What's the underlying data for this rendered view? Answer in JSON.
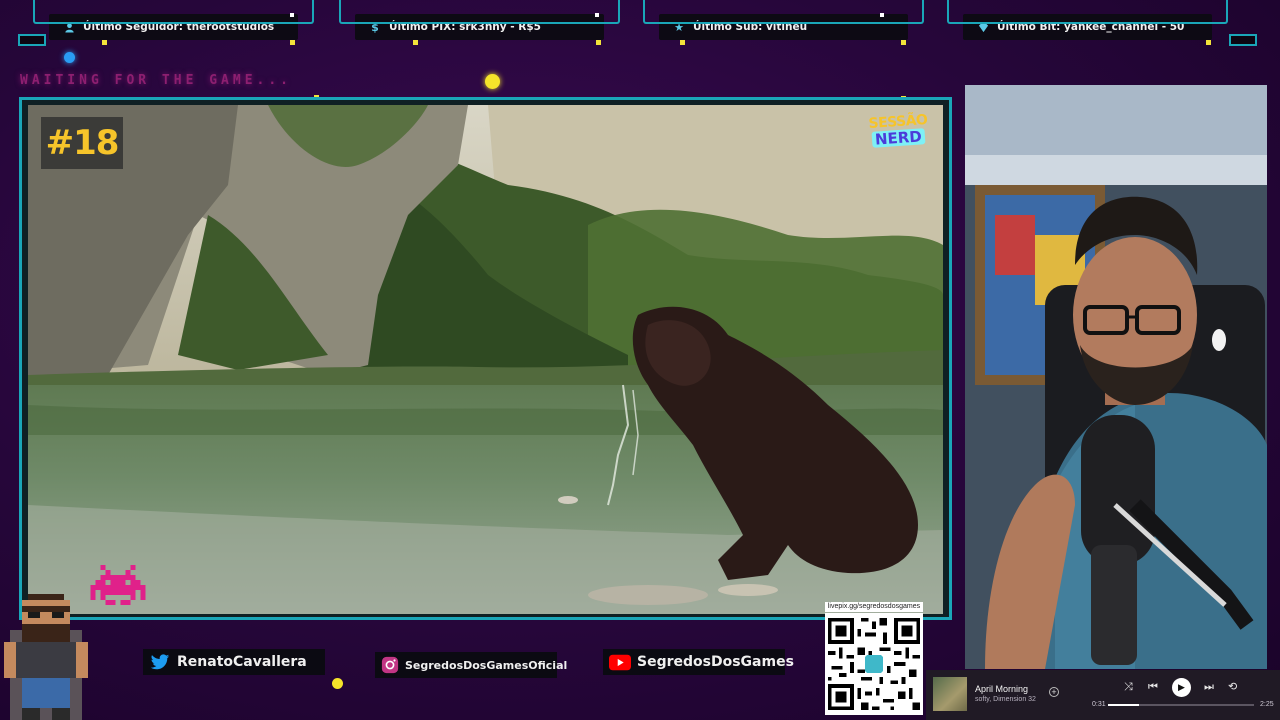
{
  "alerts": [
    {
      "icon": "person-icon",
      "text": "Último Seguidor: therootstudios"
    },
    {
      "icon": "dollar-icon",
      "text": "Último PIX: srk3nny - R$5"
    },
    {
      "icon": "star-icon",
      "text": "Último Sub: vitineu"
    },
    {
      "icon": "diamond-icon",
      "text": "Último Bit: yankee_channel - 50"
    }
  ],
  "waiting_text": "WAITING FOR THE GAME...",
  "episode": "#18",
  "brand": {
    "line1": "SESSÃO",
    "line2": "NERD"
  },
  "social": {
    "twitter": "RenatoCavallera",
    "instagram": "SegredosDosGamesOficial",
    "youtube": "SegredosDosGames"
  },
  "qr_url": "livepix.gg/segredosdosgames",
  "player": {
    "title": "April Morning",
    "artist": "softy, Dimension 32",
    "elapsed": "0:31",
    "duration": "2:25",
    "progress": 0.21
  },
  "colors": {
    "accent_teal": "#1aa6b8",
    "badge_yellow": "#f6c42a",
    "bg_purple": "#2a063e",
    "waiting_magenta": "#8d1f70"
  }
}
